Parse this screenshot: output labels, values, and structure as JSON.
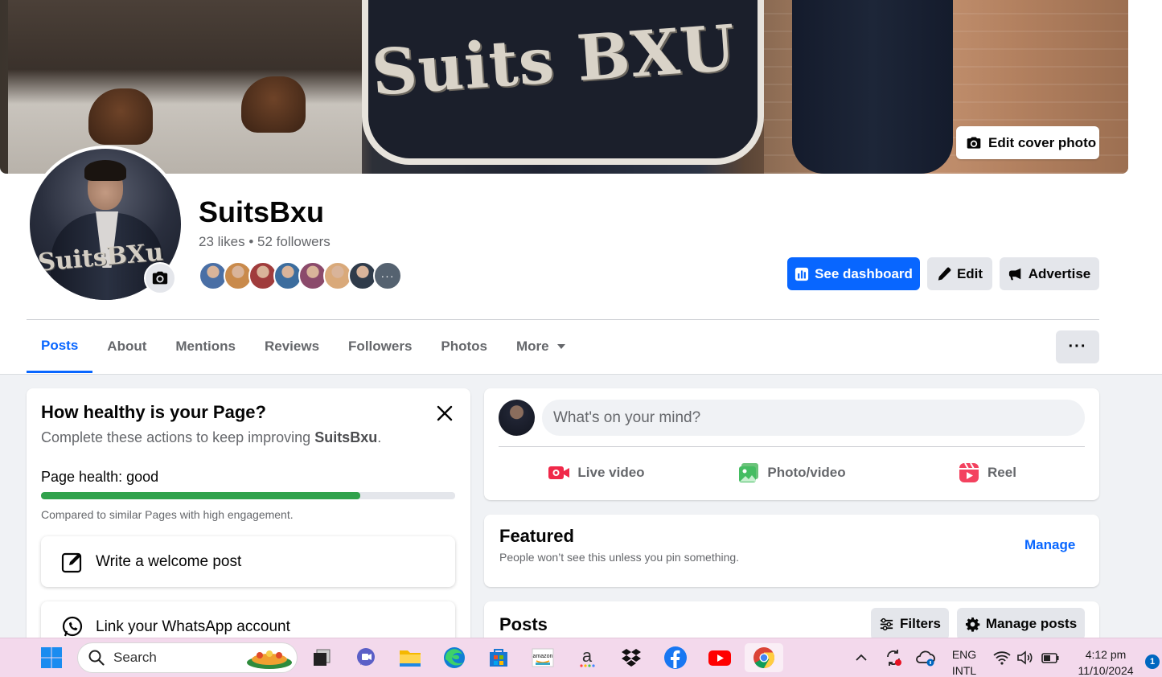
{
  "page": {
    "name": "SuitsBxu",
    "stats": "23 likes • 52 followers",
    "cover_sign_text": "Suits BXU",
    "avatar_logo_text": "SuitsBXu",
    "edit_cover_label": "Edit cover photo"
  },
  "actions": {
    "dashboard_label": "See dashboard",
    "edit_label": "Edit",
    "advertise_label": "Advertise"
  },
  "follower_faces": [
    "#4a6fa5",
    "#c98a4b",
    "#a03c3c",
    "#3c6d9e",
    "#8b4a6b",
    "#d9a97a",
    "#2f3b4a",
    "#556270"
  ],
  "tabs": [
    {
      "label": "Posts",
      "active": true
    },
    {
      "label": "About"
    },
    {
      "label": "Mentions"
    },
    {
      "label": "Reviews"
    },
    {
      "label": "Followers"
    },
    {
      "label": "Photos"
    },
    {
      "label": "More"
    }
  ],
  "health": {
    "title": "How healthy is your Page?",
    "subtitle_prefix": "Complete these actions to keep improving ",
    "subtitle_name": "SuitsBxu",
    "subtitle_suffix": ".",
    "label": "Page health: good",
    "progress": 0.77,
    "note": "Compared to similar Pages with high engagement.",
    "items": [
      "Write a welcome post",
      "Link your WhatsApp account"
    ]
  },
  "composer": {
    "placeholder": "What's on your mind?",
    "live_video": "Live video",
    "photo_video": "Photo/video",
    "reel": "Reel"
  },
  "featured": {
    "title": "Featured",
    "subtitle": "People won’t see this unless you pin something.",
    "manage": "Manage"
  },
  "posts": {
    "title": "Posts",
    "filters": "Filters",
    "manage": "Manage posts"
  },
  "taskbar": {
    "search_placeholder": "Search",
    "lang_top": "ENG",
    "lang_bottom": "INTL",
    "time": "4:12 pm",
    "date": "11/10/2024",
    "notification_count": "1"
  },
  "colors": {
    "accent": "#0866ff",
    "health_green": "#31a24c",
    "taskbar_bg": "#f3d9ec"
  }
}
